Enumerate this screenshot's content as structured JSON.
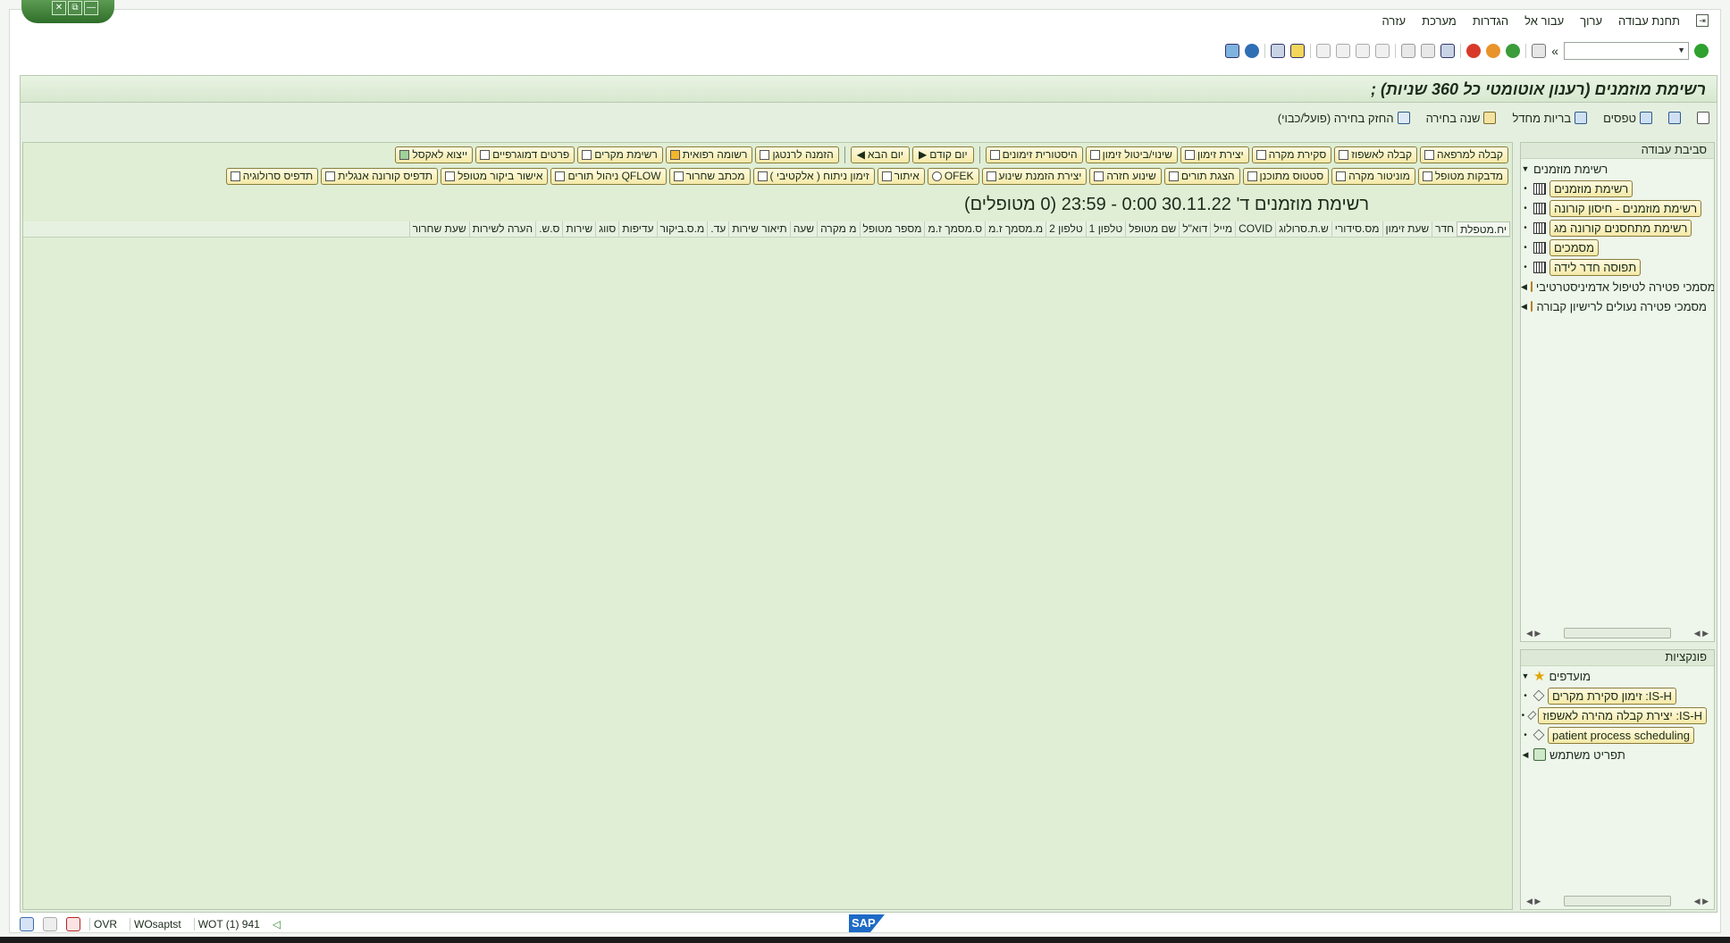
{
  "window_buttons": [
    "✕",
    "⧉",
    "—"
  ],
  "menu": [
    "תחנת עבודה",
    "ערוך",
    "עבור אל",
    "הגדרות",
    "מערכת",
    "עזרה"
  ],
  "toolbar": {
    "command_value": ""
  },
  "title": "רשימת מוזמנים (רענון אוטומטי כל 360 שניות)  ;",
  "app_toolbar": [
    "טפסים",
    "בריות מחדל",
    "שנה בחירה",
    "החזק בחירה (פועל/כבוי)"
  ],
  "buttons_row1": [
    "קבלה למרפאה",
    "קבלה לאשפוז",
    "סקירת מקרה",
    "יצירת זימון",
    "שינוי/ביטול זימון",
    "היסטורית זימונים",
    "יום קודם",
    "יום הבא",
    "הזמנה לרנטגן",
    "רשומה רפואית",
    "רשימת מקרים",
    "פרטים דמוגרפיים",
    "ייצוא לאקסל"
  ],
  "buttons_row2": [
    "מדבקות מטופל",
    "מוניטור מקרה",
    "סטטוס מתוכנן",
    "הצגת תורים",
    "שינוע חזרה",
    "יצירת הזמנת שינוע",
    "OFEK",
    "איתור",
    "זימון ניתוח ( אלקטיבי )",
    "מכתב שחרור",
    "QFLOW ניהול תורים",
    "אישור ביקור מטופל",
    "תדפיס קורונה אנגלית",
    "תדפיס סרולוגיה"
  ],
  "list_title": "רשימת מוזמנים ד' 30.11.22  0:00 - 23:59 (0  מטופלים)",
  "columns": [
    "יח.מטפלת",
    "חדר",
    "שעת זימון",
    "מס.סידורי",
    "ש.ת.סרולוג",
    "COVID",
    "מייל",
    "דוא\"ל",
    "שם מטופל",
    "טלפון 1",
    "טלפון 2",
    "מ.מסמך ז.מ",
    "ס.מסמך ז.מ",
    "מספר מטופל",
    "מ מקרה",
    "שעה",
    "תיאור שירות",
    "עד.",
    "מ.ס.ביקור",
    "עדיפות",
    "סווג",
    "שירות",
    "ס.ש.",
    "הערה לשירות",
    "שעת שחרור"
  ],
  "work_env": {
    "header": "סביבת עבודה",
    "root": "רשימת מוזמנים",
    "items": [
      "רשימת מוזמנים",
      "רשימת מוזמנים - חיסון קורונה",
      "רשימת מתחסנים קורונה מג",
      "מסמכים",
      "תפוסה חדר לידה"
    ],
    "folders": [
      "מסמכי פטירה לטיפול אדמיניסטרטיבי",
      "מסמכי פטירה נעולים לרישיון קבורה"
    ]
  },
  "functions": {
    "header": "פונקציות",
    "favorites": "מועדפים",
    "items": [
      "IS-H: זימון סקירת מקרים",
      "IS-H: יצירת קבלה מהירה לאשפוז",
      "patient process scheduling"
    ],
    "user_menu": "תפריט משתמש"
  },
  "status": {
    "mode": "OVR",
    "server": "WOsaptst",
    "session": "WOT (1) 941"
  },
  "logo_text": "SAP"
}
